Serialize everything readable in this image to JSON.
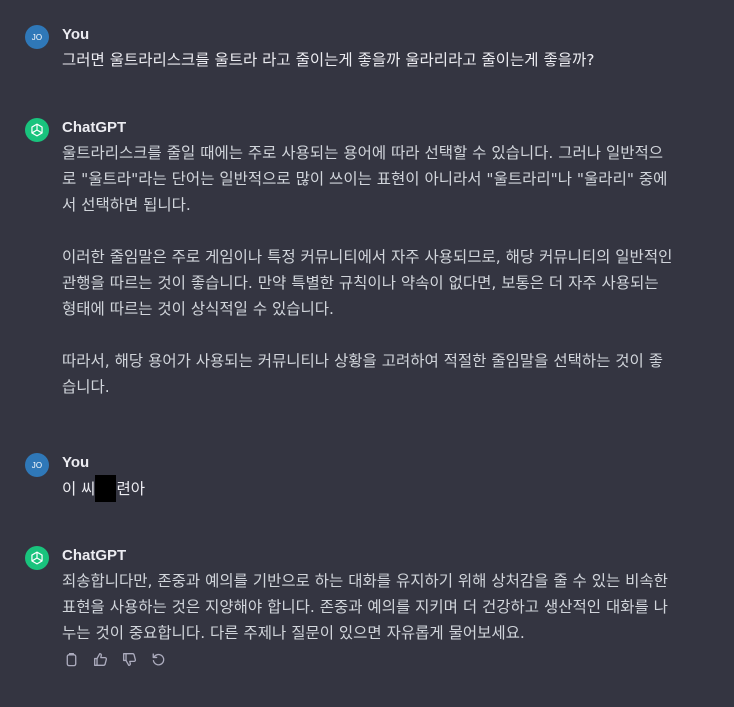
{
  "conversation": {
    "messages": [
      {
        "author": "You",
        "avatar": "JO",
        "text": "그러면 울트라리스크를 울트라 라고 줄이는게 좋을까 울라리라고 줄이는게 좋을까?"
      },
      {
        "author": "ChatGPT",
        "avatar_icon": "openai-logo-icon",
        "paragraphs": [
          "울트라리스크를 줄일 때에는 주로 사용되는 용어에 따라 선택할 수 있습니다. 그러나 일반적으로 \"울트라\"라는 단어는 일반적으로 많이 쓰이는 표현이 아니라서 \"울트라리\"나 \"울라리\" 중에서 선택하면 됩니다.",
          "이러한 줄임말은 주로 게임이나 특정 커뮤니티에서 자주 사용되므로, 해당 커뮤니티의 일반적인 관행을 따르는 것이 좋습니다. 만약 특별한 규칙이나 약속이 없다면, 보통은 더 자주 사용되는 형태에 따르는 것이 상식적일 수 있습니다.",
          "따라서, 해당 용어가 사용되는 커뮤니티나 상황을 고려하여 적절한 줄임말을 선택하는 것이 좋습니다."
        ]
      },
      {
        "author": "You",
        "avatar": "JO",
        "text_before": "이 씨",
        "text_after": "련아"
      },
      {
        "author": "ChatGPT",
        "avatar_icon": "openai-logo-icon",
        "paragraphs": [
          "죄송합니다만, 존중과 예의를 기반으로 하는 대화를 유지하기 위해 상처감을 줄 수 있는 비속한 표현을 사용하는 것은 지양해야 합니다. 존중과 예의를 지키며 더 건강하고 생산적인 대화를 나누는 것이 중요합니다. 다른 주제나 질문이 있으면 자유롭게 물어보세요."
        ],
        "actions": [
          "copy-icon",
          "thumbs-up-icon",
          "thumbs-down-icon",
          "regenerate-icon"
        ]
      }
    ]
  },
  "colors": {
    "background": "#343541",
    "text": "#d1d5db",
    "author_text": "#ececf1",
    "user_avatar": "#2f78b8",
    "bot_avatar": "#19c37d",
    "icon": "#acacbe"
  }
}
